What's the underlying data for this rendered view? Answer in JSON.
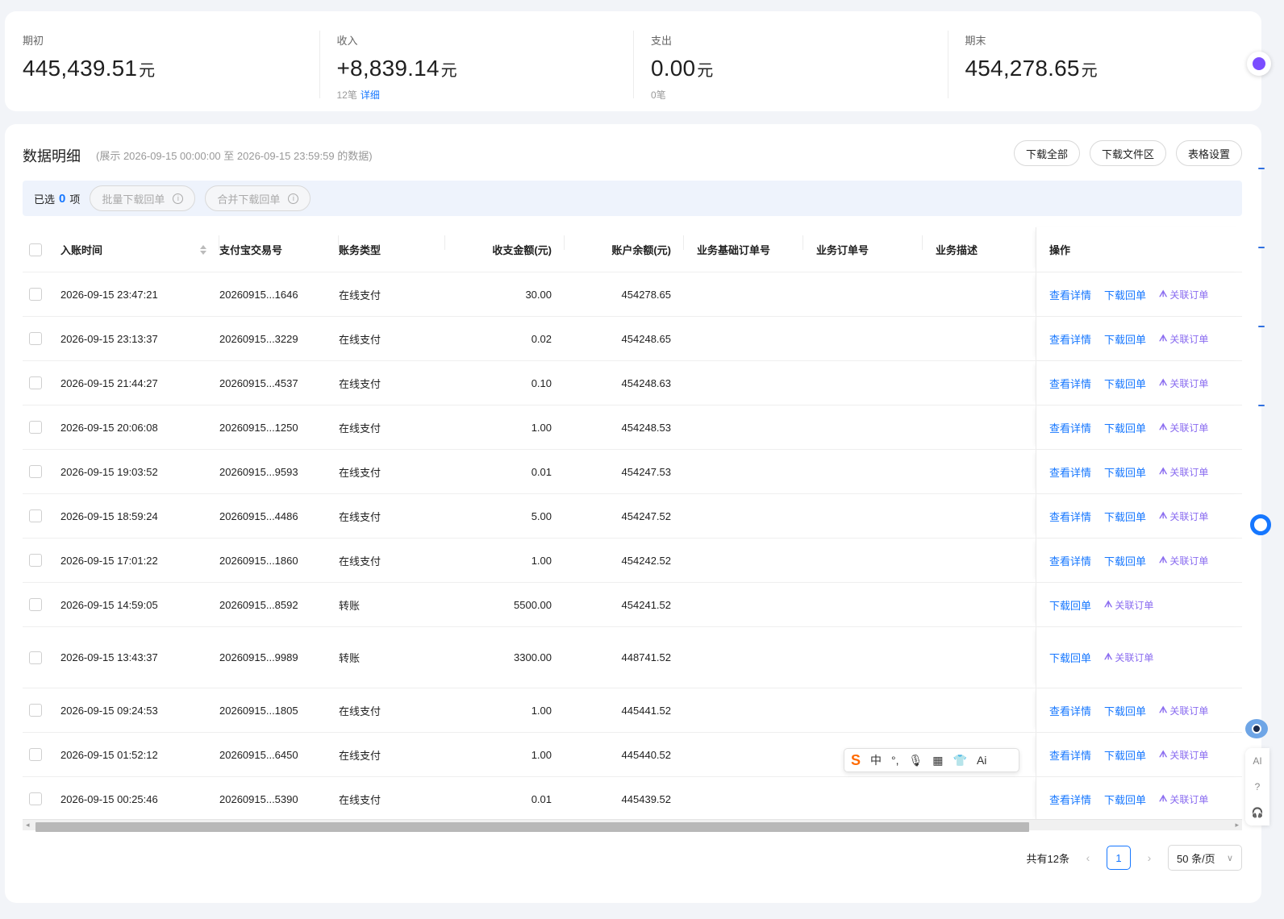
{
  "summary": {
    "opening": {
      "label": "期初",
      "value": "445,439.51",
      "unit": "元"
    },
    "income": {
      "label": "收入",
      "value": "+8,839.14",
      "unit": "元",
      "count": "12笔",
      "detail": "详细"
    },
    "expense": {
      "label": "支出",
      "value": "0.00",
      "unit": "元",
      "count": "0笔"
    },
    "closing": {
      "label": "期末",
      "value": "454,278.65",
      "unit": "元"
    }
  },
  "panel": {
    "title": "数据明细",
    "range": "(展示 2026-09-15 00:00:00 至 2026-09-15 23:59:59 的数据)",
    "buttons": {
      "download_all": "下载全部",
      "download_area": "下载文件区",
      "table_settings": "表格设置"
    }
  },
  "selection": {
    "prefix": "已选",
    "count": "0",
    "suffix": "项",
    "batch_download": "批量下载回单",
    "merge_download": "合并下载回单",
    "info_glyph": "i"
  },
  "table": {
    "headers": {
      "time": "入账时间",
      "trade_no": "支付宝交易号",
      "type": "账务类型",
      "amount": "收支金额(元)",
      "balance": "账户余额(元)",
      "base_order": "业务基础订单号",
      "order": "业务订单号",
      "desc": "业务描述",
      "ops": "操作"
    },
    "actions": {
      "view": "查看详情",
      "download": "下载回单",
      "relate": "关联订单",
      "relate_icon": "ᗑ"
    },
    "rows": [
      {
        "time": "2026-09-15 23:47:21",
        "trade_no": "20260915...1646",
        "type": "在线支付",
        "amount": "30.00",
        "balance": "454278.65",
        "view": true
      },
      {
        "time": "2026-09-15 23:13:37",
        "trade_no": "20260915...3229",
        "type": "在线支付",
        "amount": "0.02",
        "balance": "454248.65",
        "view": true
      },
      {
        "time": "2026-09-15 21:44:27",
        "trade_no": "20260915...4537",
        "type": "在线支付",
        "amount": "0.10",
        "balance": "454248.63",
        "view": true
      },
      {
        "time": "2026-09-15 20:06:08",
        "trade_no": "20260915...1250",
        "type": "在线支付",
        "amount": "1.00",
        "balance": "454248.53",
        "view": true
      },
      {
        "time": "2026-09-15 19:03:52",
        "trade_no": "20260915...9593",
        "type": "在线支付",
        "amount": "0.01",
        "balance": "454247.53",
        "view": true
      },
      {
        "time": "2026-09-15 18:59:24",
        "trade_no": "20260915...4486",
        "type": "在线支付",
        "amount": "5.00",
        "balance": "454247.52",
        "view": true
      },
      {
        "time": "2026-09-15 17:01:22",
        "trade_no": "20260915...1860",
        "type": "在线支付",
        "amount": "1.00",
        "balance": "454242.52",
        "view": true
      },
      {
        "time": "2026-09-15 14:59:05",
        "trade_no": "20260915...8592",
        "type": "转账",
        "amount": "5500.00",
        "balance": "454241.52",
        "view": false
      },
      {
        "time": "2026-09-15 13:43:37",
        "trade_no": "20260915...9989",
        "type": "转账",
        "amount": "3300.00",
        "balance": "448741.52",
        "view": false
      },
      {
        "time": "2026-09-15 09:24:53",
        "trade_no": "20260915...1805",
        "type": "在线支付",
        "amount": "1.00",
        "balance": "445441.52",
        "view": true
      },
      {
        "time": "2026-09-15 01:52:12",
        "trade_no": "20260915...6450",
        "type": "在线支付",
        "amount": "1.00",
        "balance": "445440.52",
        "view": true
      },
      {
        "time": "2026-09-15 00:25:46",
        "trade_no": "20260915...5390",
        "type": "在线支付",
        "amount": "0.01",
        "balance": "445439.52",
        "view": true
      }
    ]
  },
  "pager": {
    "total": "共有12条",
    "current": "1",
    "page_size": "50 条/页",
    "prev": "‹",
    "next": "›",
    "size_chevron": "∨"
  },
  "scroll": {
    "left": "◂",
    "right": "▸"
  },
  "ime": {
    "logo": "S",
    "lang": "中",
    "punct": "°,",
    "mic": "🎙",
    "keyboard": "▦",
    "skin": "👕",
    "ai": "Ai"
  },
  "float_tools": {
    "ai": "AI",
    "help": "?",
    "service": "🎧"
  }
}
